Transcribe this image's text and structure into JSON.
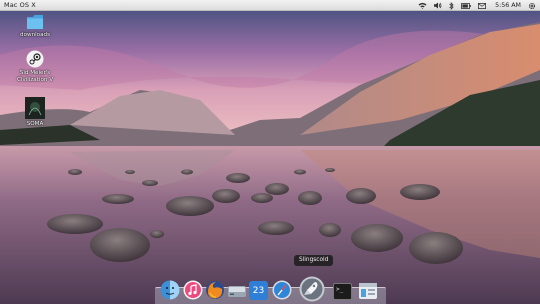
{
  "top_panel": {
    "title": "Mac OS X",
    "indicators": [
      "wifi-icon",
      "volume-icon",
      "bluetooth-icon",
      "battery-icon",
      "mail-icon"
    ],
    "clock": "5:56 AM"
  },
  "desktop_icons": [
    {
      "name": "folder-icon",
      "label_lines": [
        "downloads"
      ]
    },
    {
      "name": "steam-icon",
      "label_lines": [
        "Sid Meier's",
        "Civilization V"
      ]
    },
    {
      "name": "soma-icon",
      "label_lines": [
        "SOMA"
      ]
    }
  ],
  "dock": {
    "tooltip": "Slingscold",
    "items": [
      {
        "name": "finder-icon"
      },
      {
        "name": "itunes-icon"
      },
      {
        "name": "firefox-icon"
      },
      {
        "name": "drive-icon"
      },
      {
        "name": "calendar-icon",
        "text": "23"
      },
      {
        "name": "safari-icon"
      },
      {
        "name": "rocket-icon"
      },
      {
        "name": "terminal-icon",
        "text": ">_"
      },
      {
        "name": "finder-window-icon"
      }
    ]
  },
  "colors": {
    "panel": "#e6e6e6",
    "dock_shelf": "#dce1eb",
    "tooltip": "#1e1e1e"
  }
}
